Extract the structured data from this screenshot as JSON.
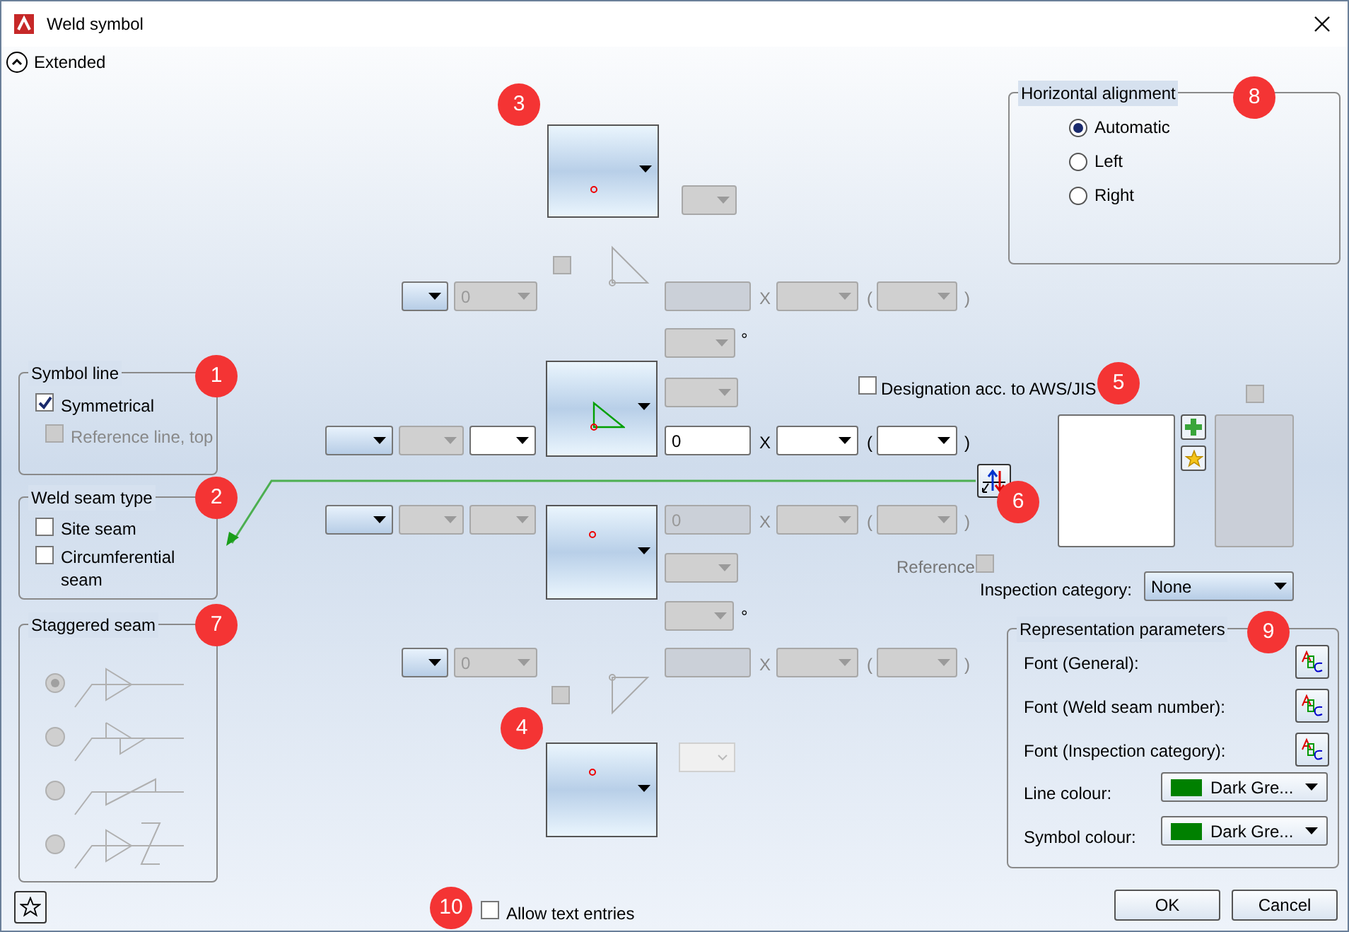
{
  "window": {
    "title": "Weld symbol"
  },
  "extended": {
    "label": "Extended",
    "expanded": true
  },
  "symbol_line": {
    "title": "Symbol line",
    "options": [
      {
        "label": "Symmetrical",
        "checked": true,
        "disabled": false
      },
      {
        "label": "Reference line, top",
        "checked": false,
        "disabled": true
      }
    ]
  },
  "weld_seam_type": {
    "title": "Weld seam type",
    "options": [
      {
        "label": "Site seam",
        "checked": false
      },
      {
        "label": "Circumferential seam",
        "checked": false
      }
    ]
  },
  "staggered_seam": {
    "title": "Staggered seam",
    "disabled": true,
    "options": [
      {
        "kind": "symmetric",
        "selected": true
      },
      {
        "kind": "staggered",
        "selected": false
      },
      {
        "kind": "chain",
        "selected": false
      },
      {
        "kind": "zigzag",
        "selected": false
      }
    ]
  },
  "upper_symbol": {
    "checked": false
  },
  "dimension_rows": [
    {
      "disabled": true,
      "size": "0",
      "value": "",
      "times": "X",
      "open": "(",
      "close": ")"
    },
    {
      "disabled": false,
      "value": "0",
      "times": "X",
      "open": "(",
      "close": ")"
    },
    {
      "disabled": true,
      "value": "0",
      "times": "X",
      "open": "(",
      "close": ")"
    },
    {
      "disabled": true,
      "size": "0",
      "value": "",
      "times": "X",
      "open": "(",
      "close": ")"
    }
  ],
  "angle_rows": [
    {
      "degree": "°"
    },
    {
      "degree": "°"
    }
  ],
  "lower_symbol": {
    "checked": false
  },
  "designation": {
    "label": "Designation acc. to AWS/JIS",
    "checked": false
  },
  "extra_panel": {
    "checked": false
  },
  "reference": {
    "label": "Reference",
    "checked": false,
    "disabled": true
  },
  "inspection_category": {
    "label": "Inspection category:",
    "value": "None"
  },
  "horizontal_alignment": {
    "title": "Horizontal alignment",
    "options": [
      {
        "label": "Automatic",
        "selected": true
      },
      {
        "label": "Left",
        "selected": false
      },
      {
        "label": "Right",
        "selected": false
      }
    ]
  },
  "representation": {
    "title": "Representation parameters",
    "fonts": [
      {
        "label": "Font (General):"
      },
      {
        "label": "Font (Weld seam number):"
      },
      {
        "label": "Font (Inspection category):"
      }
    ],
    "colours": [
      {
        "label": "Line colour:",
        "value": "Dark Gre...",
        "color": "#008000"
      },
      {
        "label": "Symbol colour:",
        "value": "Dark Gre...",
        "color": "#008000"
      }
    ]
  },
  "allow_text": {
    "label": "Allow text entries",
    "checked": false
  },
  "buttons": [
    "OK",
    "Cancel"
  ],
  "callouts": [
    "1",
    "2",
    "3",
    "4",
    "5",
    "6",
    "7",
    "8",
    "9",
    "10"
  ]
}
